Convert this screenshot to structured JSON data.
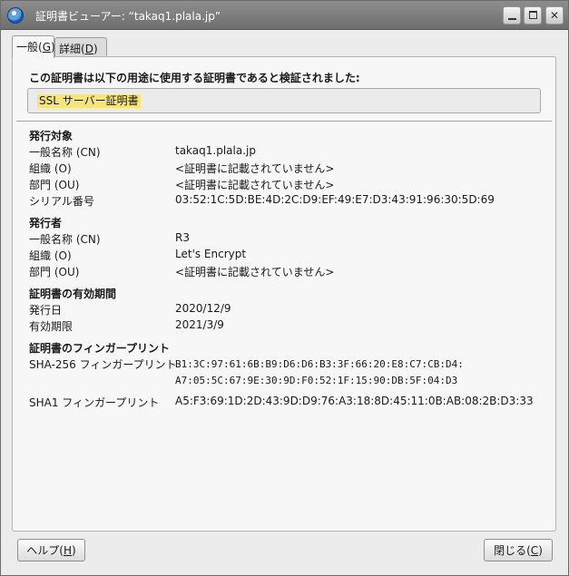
{
  "window": {
    "title": "証明書ビューアー: “takaq1.plala.jp”",
    "buttons": {
      "minimize": "_",
      "maximize": "□",
      "close": "✕"
    }
  },
  "tabs": [
    {
      "label": "一般(",
      "mnemonic": "G",
      "suffix": ")",
      "active": true
    },
    {
      "label": "詳細(",
      "mnemonic": "D",
      "suffix": ")",
      "active": false
    }
  ],
  "verified": {
    "label": "この証明書は以下の用途に使用する証明書であると検証されました:",
    "usage": "SSL サーバー証明書"
  },
  "issued_to": {
    "title": "発行対象",
    "rows": [
      {
        "label": "一般名称 (CN)",
        "value": "takaq1.plala.jp"
      },
      {
        "label": "組織 (O)",
        "value": "<証明書に記載されていません>"
      },
      {
        "label": "部門 (OU)",
        "value": "<証明書に記載されていません>"
      },
      {
        "label": "シリアル番号",
        "value": "03:52:1C:5D:BE:4D:2C:D9:EF:49:E7:D3:43:91:96:30:5D:69"
      }
    ]
  },
  "issued_by": {
    "title": "発行者",
    "rows": [
      {
        "label": "一般名称 (CN)",
        "value": "R3"
      },
      {
        "label": "組織 (O)",
        "value": "Let's Encrypt"
      },
      {
        "label": "部門 (OU)",
        "value": "<証明書に記載されていません>"
      }
    ]
  },
  "validity": {
    "title": "証明書の有効期間",
    "rows": [
      {
        "label": "発行日",
        "value": "2020/12/9"
      },
      {
        "label": "有効期限",
        "value": "2021/3/9"
      }
    ]
  },
  "fingerprints": {
    "title": "証明書のフィンガープリント",
    "sha256_label": "SHA-256 フィンガープリント",
    "sha256_line1": "B1:3C:97:61:6B:B9:D6:D6:B3:3F:66:20:E8:C7:CB:D4:",
    "sha256_line2": "A7:05:5C:67:9E:30:9D:F0:52:1F:15:90:DB:5F:04:D3",
    "sha1_label": "SHA1 フィンガープリント",
    "sha1_value": "A5:F3:69:1D:2D:43:9D:D9:76:A3:18:8D:45:11:0B:AB:08:2B:D3:33"
  },
  "footer": {
    "help_label": "ヘルプ(",
    "help_mnemonic": "H",
    "help_suffix": ")",
    "close_label": "閉じる(",
    "close_mnemonic": "C",
    "close_suffix": ")"
  }
}
